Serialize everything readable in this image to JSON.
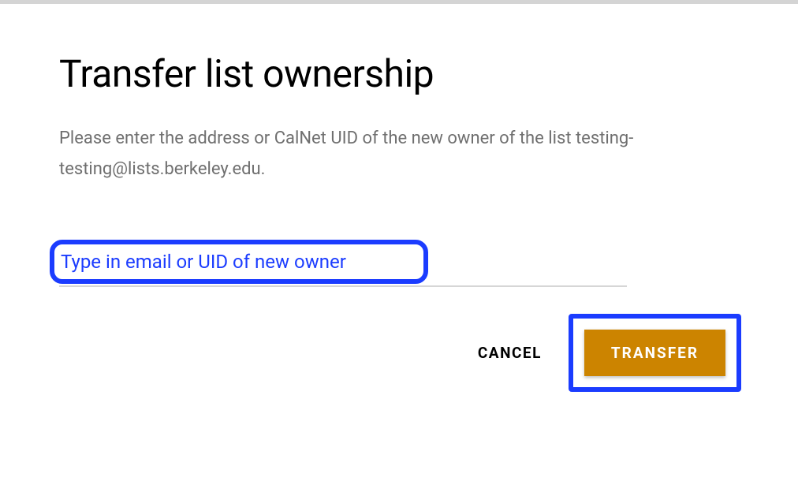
{
  "dialog": {
    "title": "Transfer list ownership",
    "description": "Please enter the address or CalNet UID of the new owner of the list testing-testing@lists.berkeley.edu.",
    "input_placeholder": "Type in email or UID of new owner",
    "cancel_label": "CANCEL",
    "transfer_label": "TRANSFER"
  },
  "colors": {
    "highlight": "#1b3cff",
    "primary_button": "#cc8400"
  }
}
